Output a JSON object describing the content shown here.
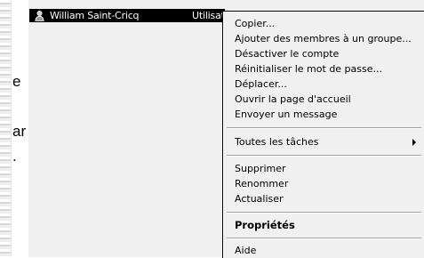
{
  "left_fragments": [
    "e",
    "ar",
    "."
  ],
  "selected_row": {
    "name": "William Saint-Cricq",
    "type": "Utilisate",
    "icon": "user-icon"
  },
  "context_menu": {
    "items": [
      {
        "label": "Copier..."
      },
      {
        "label": "Ajouter des membres à un groupe..."
      },
      {
        "label": "Désactiver le compte"
      },
      {
        "label": "Réinitialiser le mot de passe..."
      },
      {
        "label": "Déplacer..."
      },
      {
        "label": "Ouvrir la page d'accueil"
      },
      {
        "label": "Envoyer un message"
      },
      {
        "label": "Toutes les tâches",
        "submenu": true
      },
      {
        "label": "Supprimer"
      },
      {
        "label": "Renommer"
      },
      {
        "label": "Actualiser"
      },
      {
        "label": "Propriétés",
        "bold": true
      },
      {
        "label": "Aide"
      }
    ]
  }
}
